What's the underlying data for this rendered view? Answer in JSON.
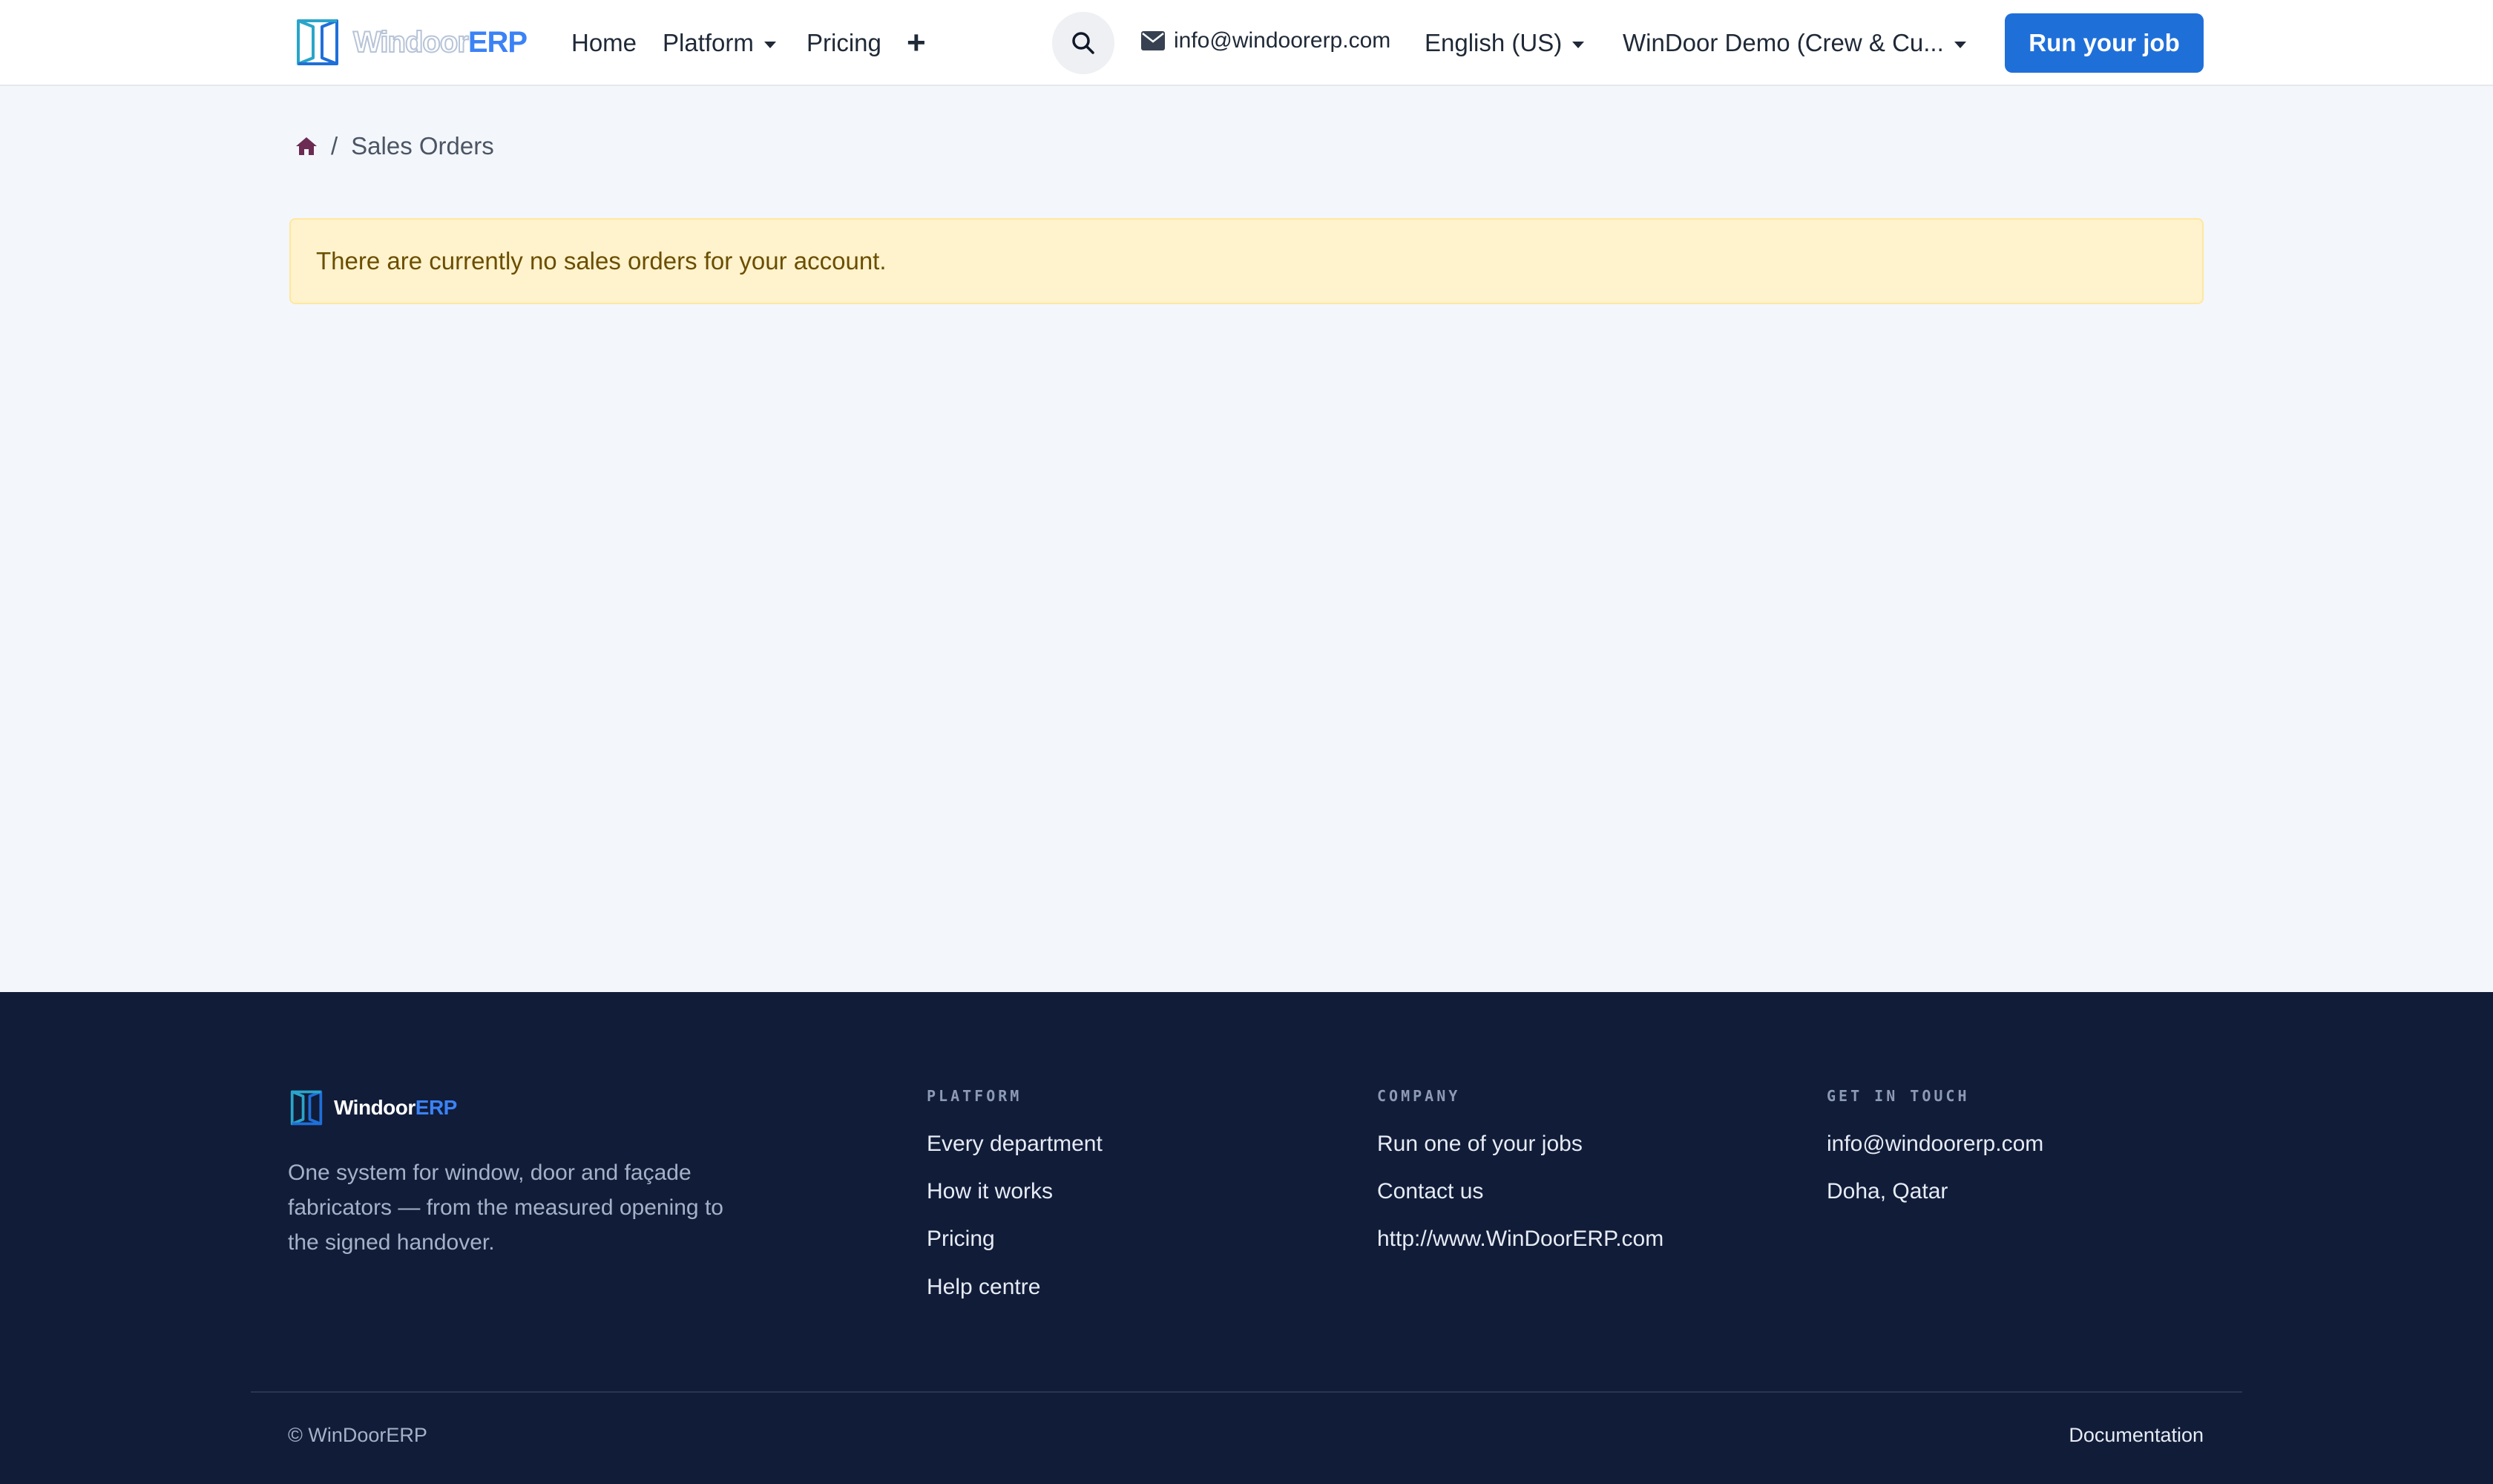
{
  "header": {
    "logo": {
      "word": "Windoor",
      "accent": "ERP"
    },
    "nav": {
      "home": "Home",
      "platform": "Platform",
      "pricing": "Pricing",
      "more_icon": "plus-icon"
    },
    "search_icon": "search-icon",
    "email": "info@windoorerp.com",
    "language": "English (US)",
    "company": "WinDoor Demo (Crew & Cu...",
    "cta": "Run your job"
  },
  "main": {
    "breadcrumb": {
      "home_icon": "home-icon",
      "separator": "/",
      "current": "Sales Orders"
    },
    "alert": "There are currently no sales orders for your account."
  },
  "footer": {
    "logo": {
      "word": "Windoor",
      "accent": "ERP"
    },
    "tagline": "One system for window, door and façade fabricators — from the measured opening to the signed handover.",
    "columns": [
      {
        "title": "PLATFORM",
        "links": [
          "Every department",
          "How it works",
          "Pricing",
          "Help centre"
        ]
      },
      {
        "title": "COMPANY",
        "links": [
          "Run one of your jobs",
          "Contact us",
          "http://www.WinDoorERP.com"
        ]
      },
      {
        "title": "GET IN TOUCH",
        "links": [
          "info@windoorerp.com",
          "Doha, Qatar"
        ]
      }
    ],
    "copyright": "© WinDoorERP",
    "docs": "Documentation"
  },
  "colors": {
    "primary": "#1f6fd9",
    "footer_bg": "#111c38",
    "alert_bg": "#fff3cd",
    "page_bg": "#f3f6fb"
  }
}
